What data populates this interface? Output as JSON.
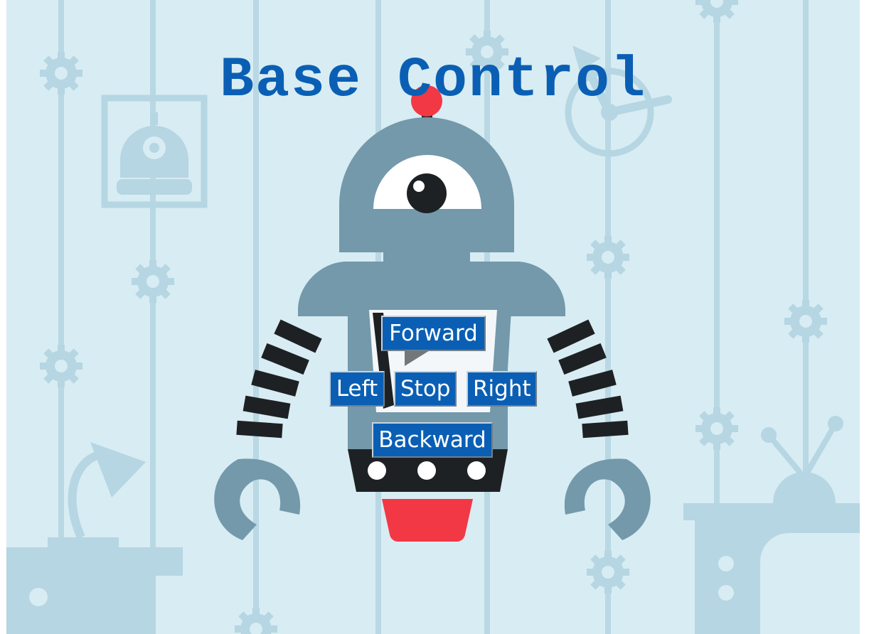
{
  "page": {
    "title": "Base Control"
  },
  "controls": {
    "forward": "Forward",
    "left": "Left",
    "stop": "Stop",
    "right": "Right",
    "backward": "Backward"
  },
  "colors": {
    "background": "#d8ecf3",
    "title": "#0a5fb4",
    "button_fill": "#0a5fb4",
    "button_text": "#ffffff",
    "robot_body": "#7399ab",
    "robot_dark": "#1e2124",
    "robot_red": "#f23845",
    "decor": "#b5d6e2"
  }
}
